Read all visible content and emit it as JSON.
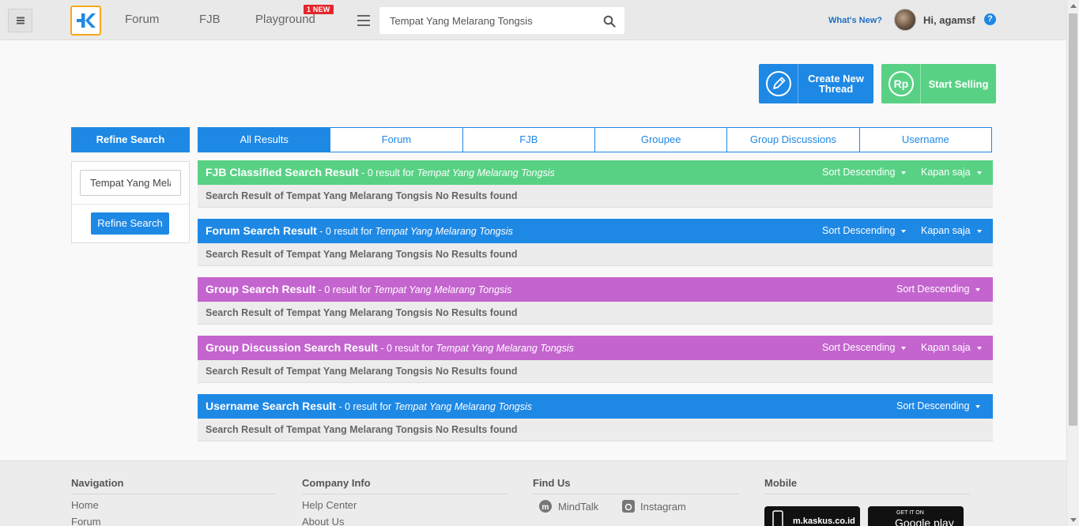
{
  "header": {
    "logo_letter": "K",
    "nav": [
      "Forum",
      "FJB",
      "Playground"
    ],
    "new_badge": "1 NEW",
    "search_value": "Tempat Yang Melarang Tongsis",
    "whats_new": "What's New?",
    "greeting": "Hi, agamsf",
    "help": "?"
  },
  "actions": {
    "create_label": "Create New Thread",
    "sell_label": "Start Selling",
    "sell_icon_text": "Rp"
  },
  "refine": {
    "title": "Refine Search",
    "input_value": "Tempat Yang Melarang Tongsis",
    "button": "Refine Search"
  },
  "tabs": [
    "All Results",
    "Forum",
    "FJB",
    "Groupee",
    "Group Discussions",
    "Username"
  ],
  "sort_label": "Sort Descending",
  "time_label": "Kapan saja",
  "query": "Tempat Yang Melarang Tongsis",
  "results": [
    {
      "title": "FJB Classified Search Result",
      "count_text": " - 0 result for ",
      "color": "#59d185",
      "has_time_filter": true,
      "empty_message": "Search Result of Tempat Yang Melarang Tongsis No Results found"
    },
    {
      "title": "Forum Search Result",
      "count_text": " - 0 result for ",
      "color": "#1e88e5",
      "has_time_filter": true,
      "empty_message": "Search Result of Tempat Yang Melarang Tongsis No Results found"
    },
    {
      "title": "Group Search Result",
      "count_text": " - 0 result for ",
      "color": "#c464cf",
      "has_time_filter": false,
      "empty_message": "Search Result of Tempat Yang Melarang Tongsis No Results found"
    },
    {
      "title": "Group Discussion Search Result",
      "count_text": " - 0 result for ",
      "color": "#c464cf",
      "has_time_filter": true,
      "empty_message": "Search Result of Tempat Yang Melarang Tongsis No Results found"
    },
    {
      "title": "Username Search Result",
      "count_text": " - 0 result for ",
      "color": "#1e88e5",
      "has_time_filter": false,
      "empty_message": "Search Result of Tempat Yang Melarang Tongsis No Results found"
    }
  ],
  "footer": {
    "navigation": {
      "title": "Navigation",
      "links": [
        "Home",
        "Forum"
      ]
    },
    "company": {
      "title": "Company Info",
      "links": [
        "Help Center",
        "About Us"
      ]
    },
    "findus": {
      "title": "Find Us",
      "links": [
        "MindTalk",
        "Instagram"
      ]
    },
    "mobile": {
      "title": "Mobile",
      "badges": [
        "m.kaskus.co.id",
        "GET IT ON",
        "Google play"
      ]
    }
  }
}
